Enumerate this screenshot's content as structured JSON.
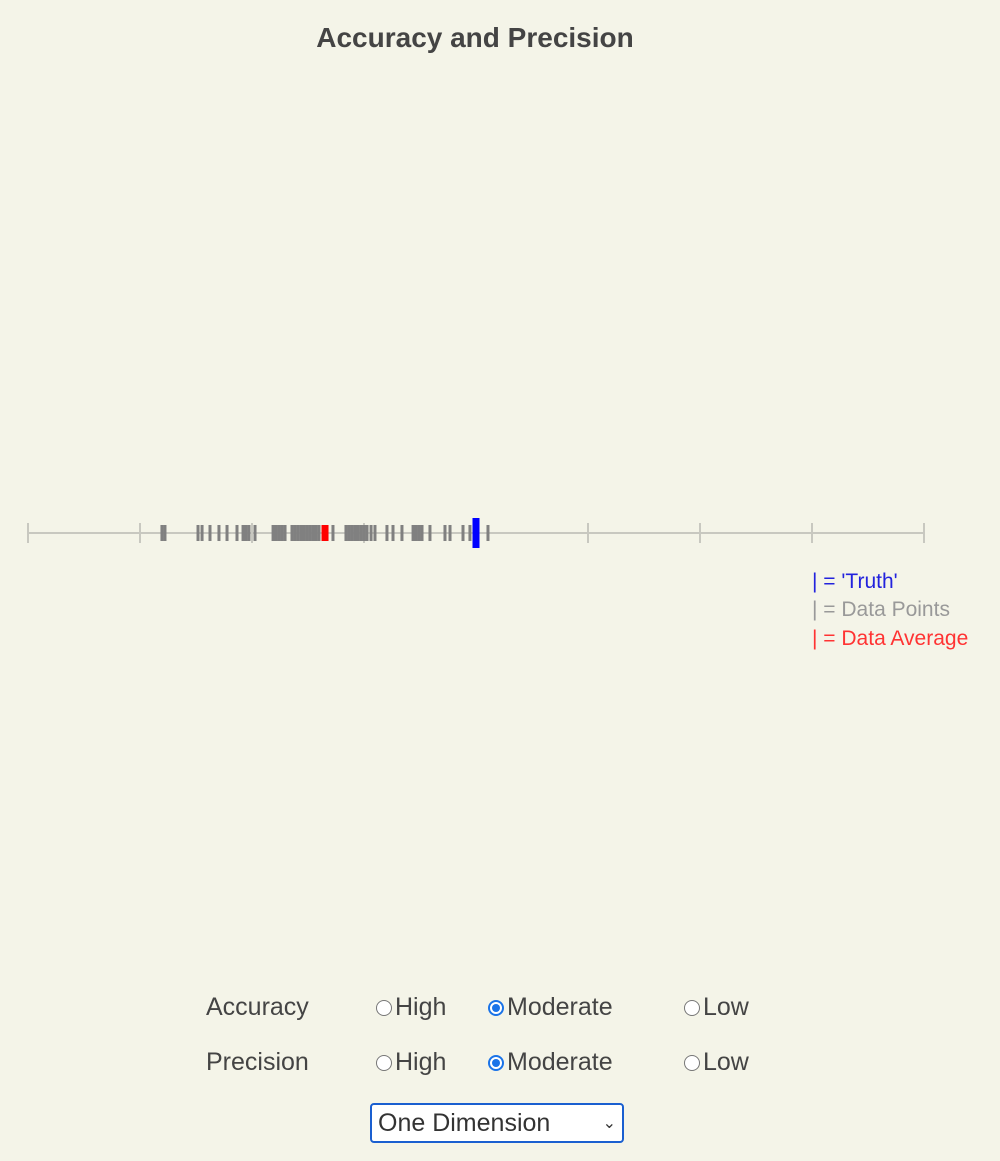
{
  "title": "Accuracy and Precision",
  "chart_data": {
    "type": "strip",
    "axis": {
      "min": 0,
      "max": 8,
      "ticks": [
        0,
        1,
        2,
        3,
        4,
        5,
        6,
        7,
        8
      ],
      "tick_labels_shown": false
    },
    "truth": 4.0,
    "average": 2.652,
    "points": [
      1.196,
      1.223,
      1.518,
      1.554,
      1.625,
      1.705,
      1.777,
      1.866,
      1.92,
      1.946,
      1.973,
      2.027,
      2.188,
      2.214,
      2.241,
      2.268,
      2.295,
      2.357,
      2.384,
      2.411,
      2.438,
      2.464,
      2.491,
      2.518,
      2.545,
      2.571,
      2.598,
      2.723,
      2.839,
      2.866,
      2.893,
      2.92,
      2.946,
      2.973,
      3.0,
      3.027,
      3.063,
      3.098,
      3.205,
      3.259,
      3.339,
      3.438,
      3.464,
      3.491,
      3.518,
      3.589,
      3.723,
      3.768,
      3.884,
      3.946,
      4.107
    ],
    "colors": {
      "truth": "#0000ff",
      "points": "#808080",
      "average": "#ff0000",
      "axis": "#c8c8c0"
    },
    "legend": [
      {
        "text": "| = 'Truth'",
        "color": "#2222dd"
      },
      {
        "text": "| = Data Points",
        "color": "#999999"
      },
      {
        "text": "| = Data Average",
        "color": "#ff3333"
      }
    ]
  },
  "controls": {
    "accuracy": {
      "label": "Accuracy",
      "options": [
        "High",
        "Moderate",
        "Low"
      ],
      "selected": "Moderate"
    },
    "precision": {
      "label": "Precision",
      "options": [
        "High",
        "Moderate",
        "Low"
      ],
      "selected": "Moderate"
    },
    "mode_select": {
      "value": "One Dimension"
    }
  }
}
